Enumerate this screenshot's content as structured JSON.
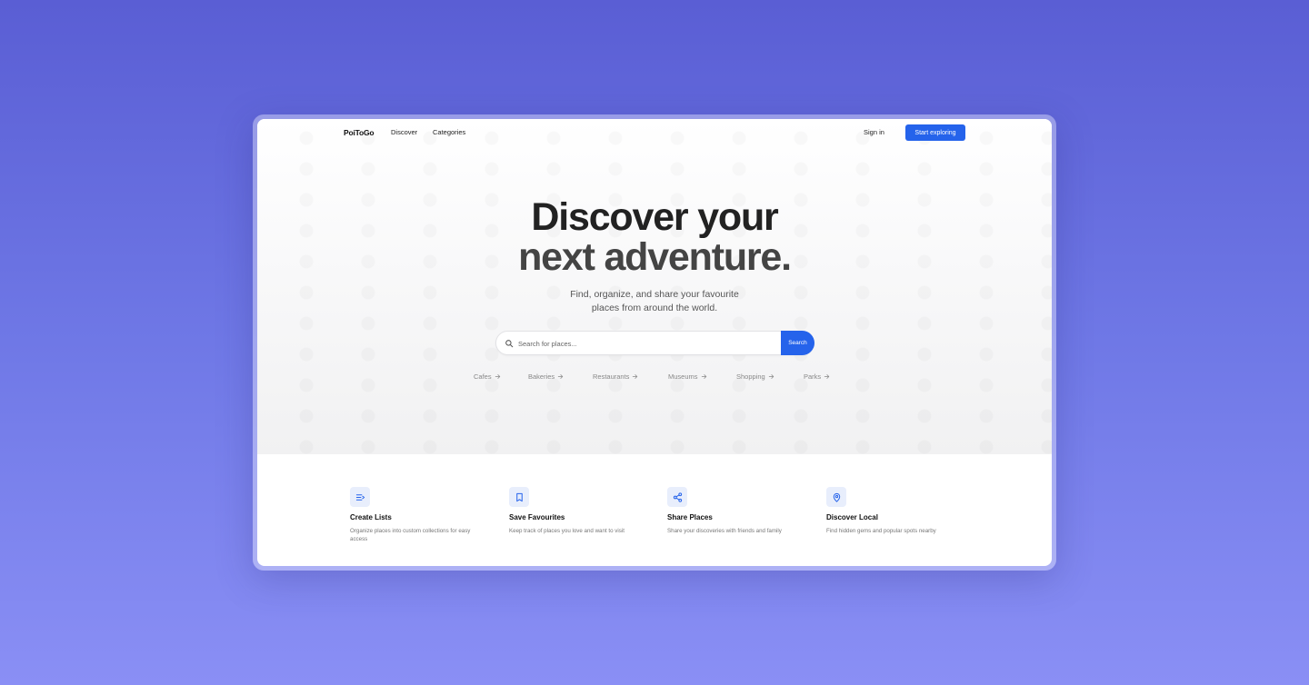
{
  "nav": {
    "logo": "PoiToGo",
    "links": [
      "Discover",
      "Categories"
    ],
    "sign_in": "Sign in",
    "cta": "Start exploring"
  },
  "hero": {
    "headline_line1": "Discover your",
    "headline_line2": "next adventure.",
    "subtitle_line1": "Find, organize, and share your favourite",
    "subtitle_line2": "places from around the world."
  },
  "search": {
    "placeholder": "Search for places...",
    "button": "Search"
  },
  "categories": [
    "Cafes",
    "Bakeries",
    "Restaurants",
    "Museums",
    "Shopping",
    "Parks"
  ],
  "features": [
    {
      "icon": "list-icon",
      "title": "Create Lists",
      "description": "Organize places into custom collections for easy access"
    },
    {
      "icon": "bookmark-icon",
      "title": "Save Favourites",
      "description": "Keep track of places you love and want to visit"
    },
    {
      "icon": "share-icon",
      "title": "Share Places",
      "description": "Share your discoveries with friends and family"
    },
    {
      "icon": "map-pin-icon",
      "title": "Discover Local",
      "description": "Find hidden gems and popular spots nearby"
    }
  ],
  "colors": {
    "accent": "#2563eb",
    "icon_bg": "#e8eefc",
    "page_bg_top": "#5a5ed4",
    "page_bg_bottom": "#8a8ff5"
  }
}
